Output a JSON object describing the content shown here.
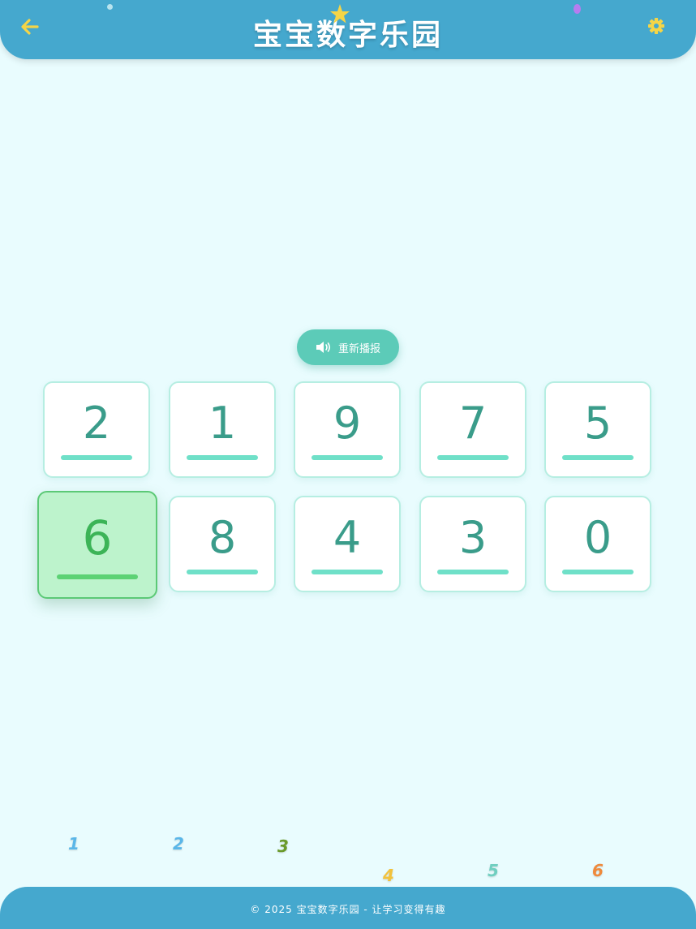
{
  "header": {
    "title": "宝宝数字乐园",
    "back_icon": "arrow-left-icon",
    "settings_icon": "gear-icon",
    "accent_color": "#f5d547",
    "bar_color": "#45a8ce"
  },
  "replay": {
    "label": "重新播报",
    "icon": "speaker-icon",
    "color": "#5ccbb8"
  },
  "cards": [
    {
      "digit": "2",
      "selected": false
    },
    {
      "digit": "1",
      "selected": false
    },
    {
      "digit": "9",
      "selected": false
    },
    {
      "digit": "7",
      "selected": false
    },
    {
      "digit": "5",
      "selected": false
    },
    {
      "digit": "6",
      "selected": true
    },
    {
      "digit": "8",
      "selected": false
    },
    {
      "digit": "4",
      "selected": false
    },
    {
      "digit": "3",
      "selected": false
    },
    {
      "digit": "0",
      "selected": false
    }
  ],
  "floating_numbers": [
    {
      "text": "1",
      "color": "#5ab6e8"
    },
    {
      "text": "2",
      "color": "#5ab6e8"
    },
    {
      "text": "3",
      "color": "#6a9a2a"
    },
    {
      "text": "4",
      "color": "#f2c23c"
    },
    {
      "text": "5",
      "color": "#6fcfc0"
    },
    {
      "text": "6",
      "color": "#ef8a3c"
    }
  ],
  "footer": {
    "text": "© 2025 宝宝数字乐园 - 让学习变得有趣"
  }
}
